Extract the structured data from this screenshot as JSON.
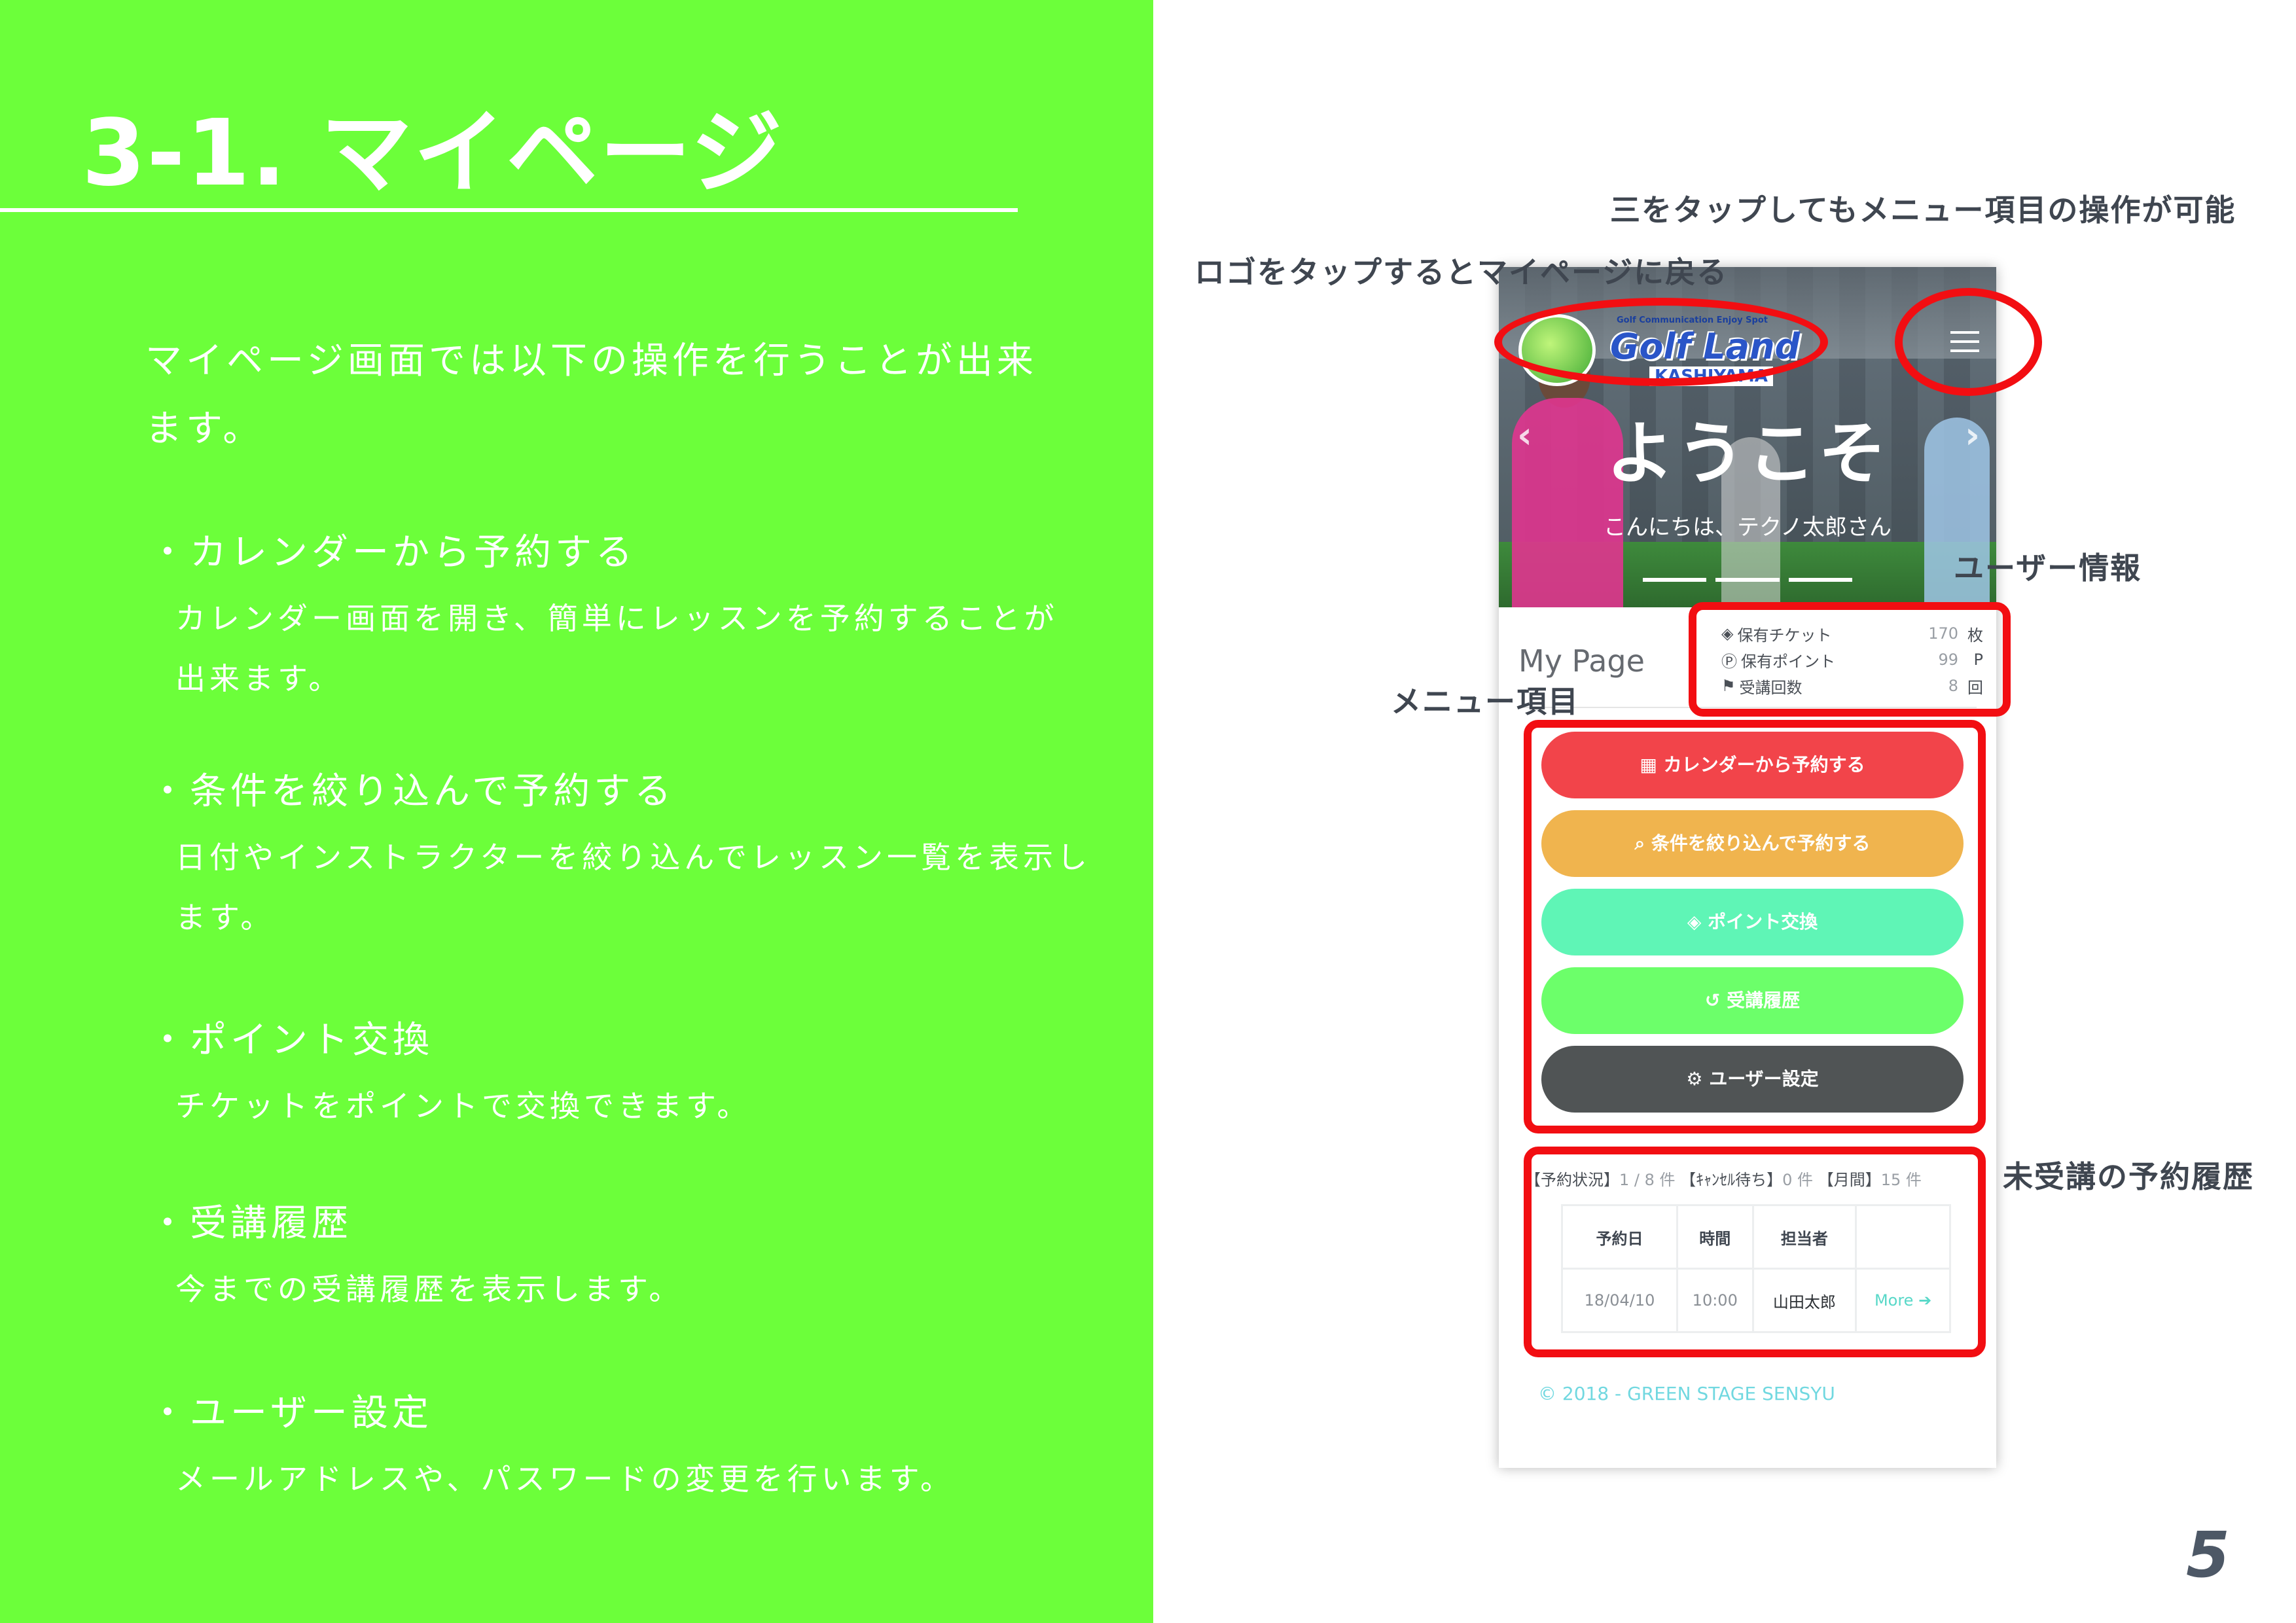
{
  "slide": {
    "title": "3-1. マイページ",
    "intro": "マイページ画面では以下の操作を行うことが出来ます。",
    "features": [
      {
        "title": "・カレンダーから予約する",
        "desc": "カレンダー画面を開き、簡単にレッスンを予約することが出来ます。"
      },
      {
        "title": "・条件を絞り込んで予約する",
        "desc": "日付やインストラクターを絞り込んでレッスン一覧を表示します。"
      },
      {
        "title": "・ポイント交換",
        "desc": "チケットをポイントで交換できます。"
      },
      {
        "title": "・受講履歴",
        "desc": "今までの受講履歴を表示します。"
      },
      {
        "title": "・ユーザー設定",
        "desc": "メールアドレスや、パスワードの変更を行います。"
      }
    ],
    "page_number": "5"
  },
  "annotations": {
    "hamburger_note": "三をタップしてもメニュー項目の操作が可能",
    "logo_note": "ロゴをタップするとマイページに戻る",
    "user_info": "ユーザー情報",
    "menu_items": "メニュー項目",
    "pending_history": "未受講の予約履歴"
  },
  "phone": {
    "logo": {
      "small": "Golf Communication Enjoy Spot",
      "main": "Golf Land",
      "sub": "KASHIYAMA"
    },
    "hero": {
      "welcome": "ようこそ",
      "greeting": "こんにちは、テクノ太郎さん",
      "prev": "‹",
      "next": "›"
    },
    "mypage_title": "My Page",
    "stats": [
      {
        "icon": "◈",
        "label": "保有チケット",
        "value": "170",
        "unit": "枚"
      },
      {
        "icon": "Ⓟ",
        "label": "保有ポイント",
        "value": "99",
        "unit": "P"
      },
      {
        "icon": "⚑",
        "label": "受講回数",
        "value": "8",
        "unit": "回"
      }
    ],
    "menu": [
      {
        "icon": "▦",
        "label": "カレンダーから予約する",
        "color": "#f2444a"
      },
      {
        "icon": "⌕",
        "label": "条件を絞り込んで予約する",
        "color": "#f0b44e"
      },
      {
        "icon": "◈",
        "label": "ポイント交換",
        "color": "#5ff5b6"
      },
      {
        "icon": "↺",
        "label": "受講履歴",
        "color": "#6cff6a"
      },
      {
        "icon": "⚙",
        "label": "ユーザー設定",
        "color": "#505455"
      }
    ],
    "reservations": {
      "status_label": "【予約状況】",
      "status_value": "1 / 8 件",
      "cancel_label": "【ｷｬﾝｾﾙ待ち】",
      "cancel_value": "0 件",
      "monthly_label": "【月間】",
      "monthly_value": "15 件",
      "columns": [
        "予約日",
        "時間",
        "担当者",
        ""
      ],
      "rows": [
        {
          "date": "18/04/10",
          "time": "10:00",
          "staff": "山田太郎",
          "more": "More ➔"
        }
      ]
    },
    "footer": "© 2018 - GREEN STAGE SENSYU"
  }
}
